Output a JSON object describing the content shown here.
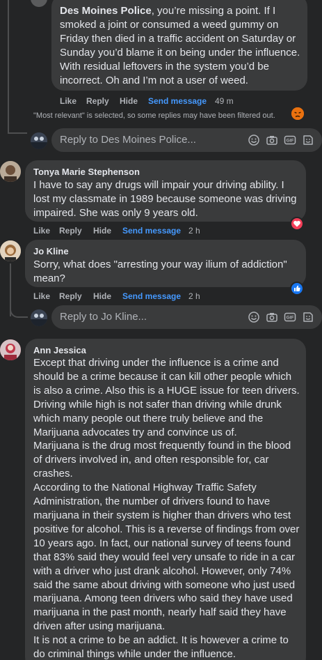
{
  "comments": [
    {
      "author": "Des Moines Police",
      "text_prefix": ", you’re missing a point. If I smoked a joint or consumed a weed gummy on Friday then died in a traffic accident on Saturday or Sunday you’d blame it on being under the influence. With residual leftovers in the system you’d be incorrect. Oh and I’m not a user of weed.",
      "like": "Like",
      "reply": "Reply",
      "hide": "Hide",
      "send": "Send message",
      "time": "49 m",
      "reaction": "angry-reaction-icon"
    },
    {
      "author": "Tonya Marie Stephenson",
      "text": "I have to say any drugs will impair your driving ability. I lost my classmate in 1989 because someone was driving impaired. She was only 9 years old.",
      "like": "Like",
      "reply": "Reply",
      "hide": "Hide",
      "send": "Send message",
      "time": "2 h",
      "reaction": "love-reaction-icon"
    },
    {
      "author": "Jo Kline",
      "text": "Sorry, what does \"arresting your way ilium of addiction\" mean?",
      "like": "Like",
      "reply": "Reply",
      "hide": "Hide",
      "send": "Send message",
      "time": "2 h",
      "reaction": "like-reaction-icon"
    },
    {
      "author": "Ann Jessica",
      "text": "Except that driving under the influence is a crime and should be a crime because it can kill other people which is also a crime. Also this is a HUGE issue for teen drivers. Driving while high is not safer than driving while drunk which many people out there truly believe and the Marijuana advocates try and convince us of.\nMarijuana is the drug most frequently found in the blood of drivers involved in, and often responsible for, car crashes.\nAccording to the National Highway Traffic Safety Administration, the number of drivers found to have marijuana in their system is higher than drivers who test positive for alcohol. This is a reverse of findings from over 10 years ago. In fact, our national survey of teens found that 83% said they would feel very unsafe to ride in a car with a driver who just drank alcohol. However, only 74% said the same about driving with someone who just used marijuana. Among teen drivers who said they have used marijuana in the past month, nearly half said they have driven after using marijuana.\nIt is not a crime to be an addict. It is however a crime to do criminal things while under the influence."
    }
  ],
  "filter_notice": "\"Most relevant\" is selected, so some replies may have been filtered out.",
  "reply_boxes": [
    {
      "placeholder": "Reply to Des Moines Police..."
    },
    {
      "placeholder": "Reply to Jo Kline..."
    }
  ],
  "reply_box_icons": [
    "emoji-icon",
    "camera-icon",
    "gif-icon",
    "sticker-icon"
  ],
  "colors": {
    "background": "#242526",
    "bubble": "#3a3b3c",
    "text": "#e4e6eb",
    "secondary_text": "#b0b3b8",
    "link": "#4599ff",
    "love": "#f33e58",
    "like": "#1877f2",
    "angry": "#e9710f"
  }
}
